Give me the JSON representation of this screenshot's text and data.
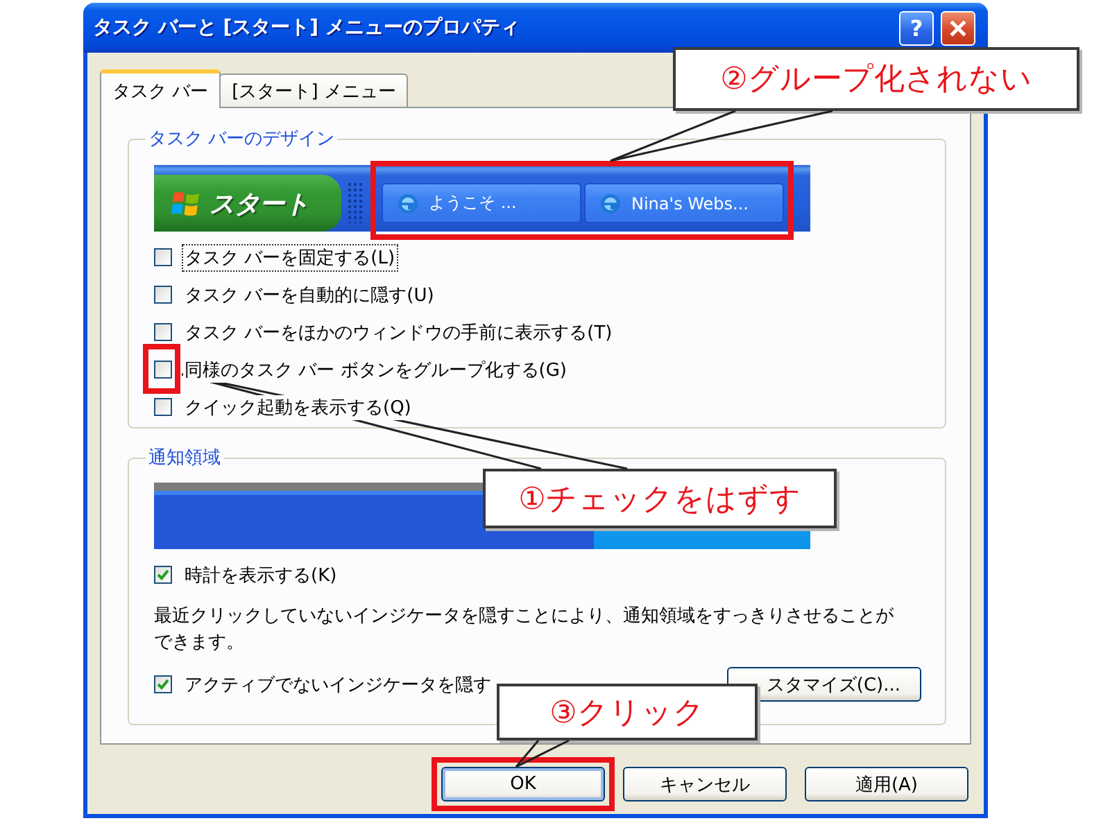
{
  "window": {
    "title": "タスク バーと [スタート] メニューのプロパティ",
    "help_label": "?"
  },
  "tabs": [
    {
      "label": "タスク バー",
      "selected": true
    },
    {
      "label": "[スタート] メニュー",
      "selected": false
    }
  ],
  "taskbar_design": {
    "title": "タスク バーのデザイン",
    "start_label": "スタート",
    "task_buttons_highlighted": true,
    "task_buttons": [
      {
        "label": "ようこそ ..."
      },
      {
        "label": "Nina's Webs..."
      }
    ],
    "options": [
      {
        "label": "タスク バーを固定する(L)",
        "checked": false,
        "focused": true,
        "highlighted": false
      },
      {
        "label": "タスク バーを自動的に隠す(U)",
        "checked": false,
        "focused": false,
        "highlighted": false
      },
      {
        "label": "タスク バーをほかのウィンドウの手前に表示する(T)",
        "checked": false,
        "focused": false,
        "highlighted": false
      },
      {
        "label": "同様のタスク バー ボタンをグループ化する(G)",
        "checked": false,
        "focused": false,
        "highlighted": true
      },
      {
        "label": "クイック起動を表示する(Q)",
        "checked": false,
        "focused": false,
        "highlighted": false
      }
    ]
  },
  "notification_area": {
    "title": "通知領域",
    "clock_option": {
      "label": "時計を表示する(K)",
      "checked": true
    },
    "description": "最近クリックしていないインジケータを隠すことにより、通知領域をすっきりさせることができます。",
    "hide_option": {
      "label": "アクティブでないインジケータを隠す",
      "checked": true
    },
    "customize_button": "スタマイズ(C)..."
  },
  "buttons": [
    {
      "label": "OK",
      "default": true,
      "highlighted": true
    },
    {
      "label": "キャンセル",
      "default": false,
      "highlighted": false
    },
    {
      "label": "適用(A)",
      "default": false,
      "highlighted": false
    }
  ],
  "callouts": [
    {
      "label": "②グループ化されない"
    },
    {
      "label": "①チェックをはずす"
    },
    {
      "label": "③クリック"
    }
  ]
}
